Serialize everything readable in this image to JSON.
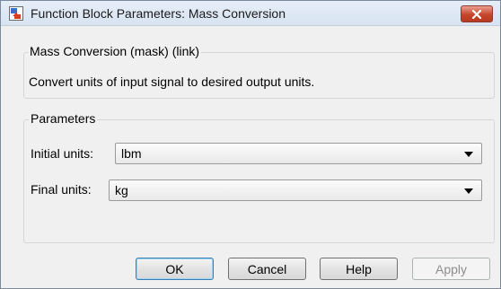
{
  "window": {
    "title": "Function Block Parameters: Mass Conversion",
    "close_icon": "close-x-icon"
  },
  "block_group": {
    "legend": "Mass Conversion (mask) (link)",
    "description": "Convert units of input signal to desired output units."
  },
  "parameters": {
    "legend": "Parameters",
    "initial_units_label": "Initial units:",
    "initial_units_value": "lbm",
    "final_units_label": "Final units:",
    "final_units_value": "kg"
  },
  "buttons": {
    "ok": "OK",
    "cancel": "Cancel",
    "help": "Help",
    "apply": "Apply"
  },
  "colors": {
    "close_button": "#c7452b",
    "default_button_border": "#3c7fb1",
    "disabled_text": "#8d8d8d"
  }
}
